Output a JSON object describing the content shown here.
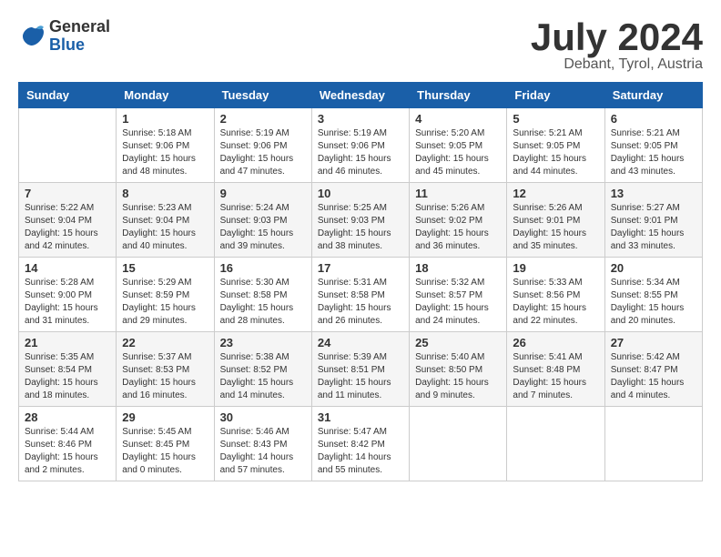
{
  "header": {
    "logo_general": "General",
    "logo_blue": "Blue",
    "title": "July 2024",
    "location": "Debant, Tyrol, Austria"
  },
  "columns": [
    "Sunday",
    "Monday",
    "Tuesday",
    "Wednesday",
    "Thursday",
    "Friday",
    "Saturday"
  ],
  "weeks": [
    [
      {
        "day": "",
        "info": ""
      },
      {
        "day": "1",
        "info": "Sunrise: 5:18 AM\nSunset: 9:06 PM\nDaylight: 15 hours\nand 48 minutes."
      },
      {
        "day": "2",
        "info": "Sunrise: 5:19 AM\nSunset: 9:06 PM\nDaylight: 15 hours\nand 47 minutes."
      },
      {
        "day": "3",
        "info": "Sunrise: 5:19 AM\nSunset: 9:06 PM\nDaylight: 15 hours\nand 46 minutes."
      },
      {
        "day": "4",
        "info": "Sunrise: 5:20 AM\nSunset: 9:05 PM\nDaylight: 15 hours\nand 45 minutes."
      },
      {
        "day": "5",
        "info": "Sunrise: 5:21 AM\nSunset: 9:05 PM\nDaylight: 15 hours\nand 44 minutes."
      },
      {
        "day": "6",
        "info": "Sunrise: 5:21 AM\nSunset: 9:05 PM\nDaylight: 15 hours\nand 43 minutes."
      }
    ],
    [
      {
        "day": "7",
        "info": "Sunrise: 5:22 AM\nSunset: 9:04 PM\nDaylight: 15 hours\nand 42 minutes."
      },
      {
        "day": "8",
        "info": "Sunrise: 5:23 AM\nSunset: 9:04 PM\nDaylight: 15 hours\nand 40 minutes."
      },
      {
        "day": "9",
        "info": "Sunrise: 5:24 AM\nSunset: 9:03 PM\nDaylight: 15 hours\nand 39 minutes."
      },
      {
        "day": "10",
        "info": "Sunrise: 5:25 AM\nSunset: 9:03 PM\nDaylight: 15 hours\nand 38 minutes."
      },
      {
        "day": "11",
        "info": "Sunrise: 5:26 AM\nSunset: 9:02 PM\nDaylight: 15 hours\nand 36 minutes."
      },
      {
        "day": "12",
        "info": "Sunrise: 5:26 AM\nSunset: 9:01 PM\nDaylight: 15 hours\nand 35 minutes."
      },
      {
        "day": "13",
        "info": "Sunrise: 5:27 AM\nSunset: 9:01 PM\nDaylight: 15 hours\nand 33 minutes."
      }
    ],
    [
      {
        "day": "14",
        "info": "Sunrise: 5:28 AM\nSunset: 9:00 PM\nDaylight: 15 hours\nand 31 minutes."
      },
      {
        "day": "15",
        "info": "Sunrise: 5:29 AM\nSunset: 8:59 PM\nDaylight: 15 hours\nand 29 minutes."
      },
      {
        "day": "16",
        "info": "Sunrise: 5:30 AM\nSunset: 8:58 PM\nDaylight: 15 hours\nand 28 minutes."
      },
      {
        "day": "17",
        "info": "Sunrise: 5:31 AM\nSunset: 8:58 PM\nDaylight: 15 hours\nand 26 minutes."
      },
      {
        "day": "18",
        "info": "Sunrise: 5:32 AM\nSunset: 8:57 PM\nDaylight: 15 hours\nand 24 minutes."
      },
      {
        "day": "19",
        "info": "Sunrise: 5:33 AM\nSunset: 8:56 PM\nDaylight: 15 hours\nand 22 minutes."
      },
      {
        "day": "20",
        "info": "Sunrise: 5:34 AM\nSunset: 8:55 PM\nDaylight: 15 hours\nand 20 minutes."
      }
    ],
    [
      {
        "day": "21",
        "info": "Sunrise: 5:35 AM\nSunset: 8:54 PM\nDaylight: 15 hours\nand 18 minutes."
      },
      {
        "day": "22",
        "info": "Sunrise: 5:37 AM\nSunset: 8:53 PM\nDaylight: 15 hours\nand 16 minutes."
      },
      {
        "day": "23",
        "info": "Sunrise: 5:38 AM\nSunset: 8:52 PM\nDaylight: 15 hours\nand 14 minutes."
      },
      {
        "day": "24",
        "info": "Sunrise: 5:39 AM\nSunset: 8:51 PM\nDaylight: 15 hours\nand 11 minutes."
      },
      {
        "day": "25",
        "info": "Sunrise: 5:40 AM\nSunset: 8:50 PM\nDaylight: 15 hours\nand 9 minutes."
      },
      {
        "day": "26",
        "info": "Sunrise: 5:41 AM\nSunset: 8:48 PM\nDaylight: 15 hours\nand 7 minutes."
      },
      {
        "day": "27",
        "info": "Sunrise: 5:42 AM\nSunset: 8:47 PM\nDaylight: 15 hours\nand 4 minutes."
      }
    ],
    [
      {
        "day": "28",
        "info": "Sunrise: 5:44 AM\nSunset: 8:46 PM\nDaylight: 15 hours\nand 2 minutes."
      },
      {
        "day": "29",
        "info": "Sunrise: 5:45 AM\nSunset: 8:45 PM\nDaylight: 15 hours\nand 0 minutes."
      },
      {
        "day": "30",
        "info": "Sunrise: 5:46 AM\nSunset: 8:43 PM\nDaylight: 14 hours\nand 57 minutes."
      },
      {
        "day": "31",
        "info": "Sunrise: 5:47 AM\nSunset: 8:42 PM\nDaylight: 14 hours\nand 55 minutes."
      },
      {
        "day": "",
        "info": ""
      },
      {
        "day": "",
        "info": ""
      },
      {
        "day": "",
        "info": ""
      }
    ]
  ]
}
